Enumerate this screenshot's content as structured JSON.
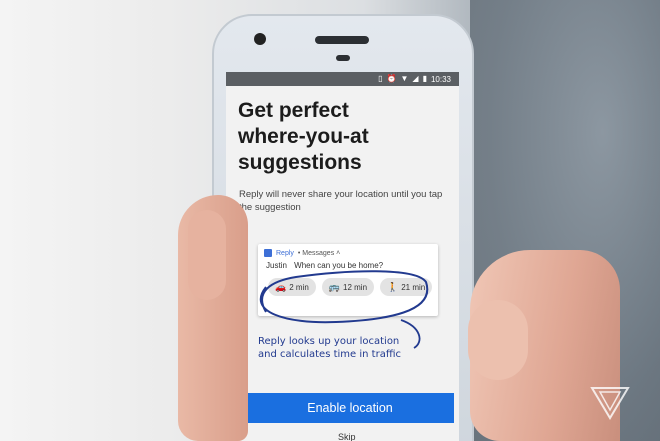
{
  "status_bar": {
    "time": "10:33",
    "icons": [
      "vibrate-icon",
      "alarm-icon",
      "wifi-icon",
      "signal-icon",
      "battery-icon"
    ]
  },
  "onboarding": {
    "title": "Get perfect\nwhere-you-at\nsuggestions",
    "subtitle": "Reply will never share your location until you tap the suggestion"
  },
  "notification": {
    "app_name": "Reply",
    "source": "• Messages ˄",
    "sender": "Justin",
    "message": "When can you be home?",
    "chips": [
      {
        "icon": "car-icon",
        "glyph": "🚗",
        "label": "2 min"
      },
      {
        "icon": "bus-icon",
        "glyph": "🚌",
        "label": "12 min"
      },
      {
        "icon": "walk-icon",
        "glyph": "🚶",
        "label": "21 min"
      }
    ]
  },
  "annotation": "Reply looks up your location\nand calculates time in traffic",
  "actions": {
    "enable_label": "Enable location",
    "skip_label": "Skip"
  },
  "colors": {
    "primary": "#1a6fe0",
    "annotation_ink": "#223a8f",
    "status_bar": "#5b5f63"
  }
}
